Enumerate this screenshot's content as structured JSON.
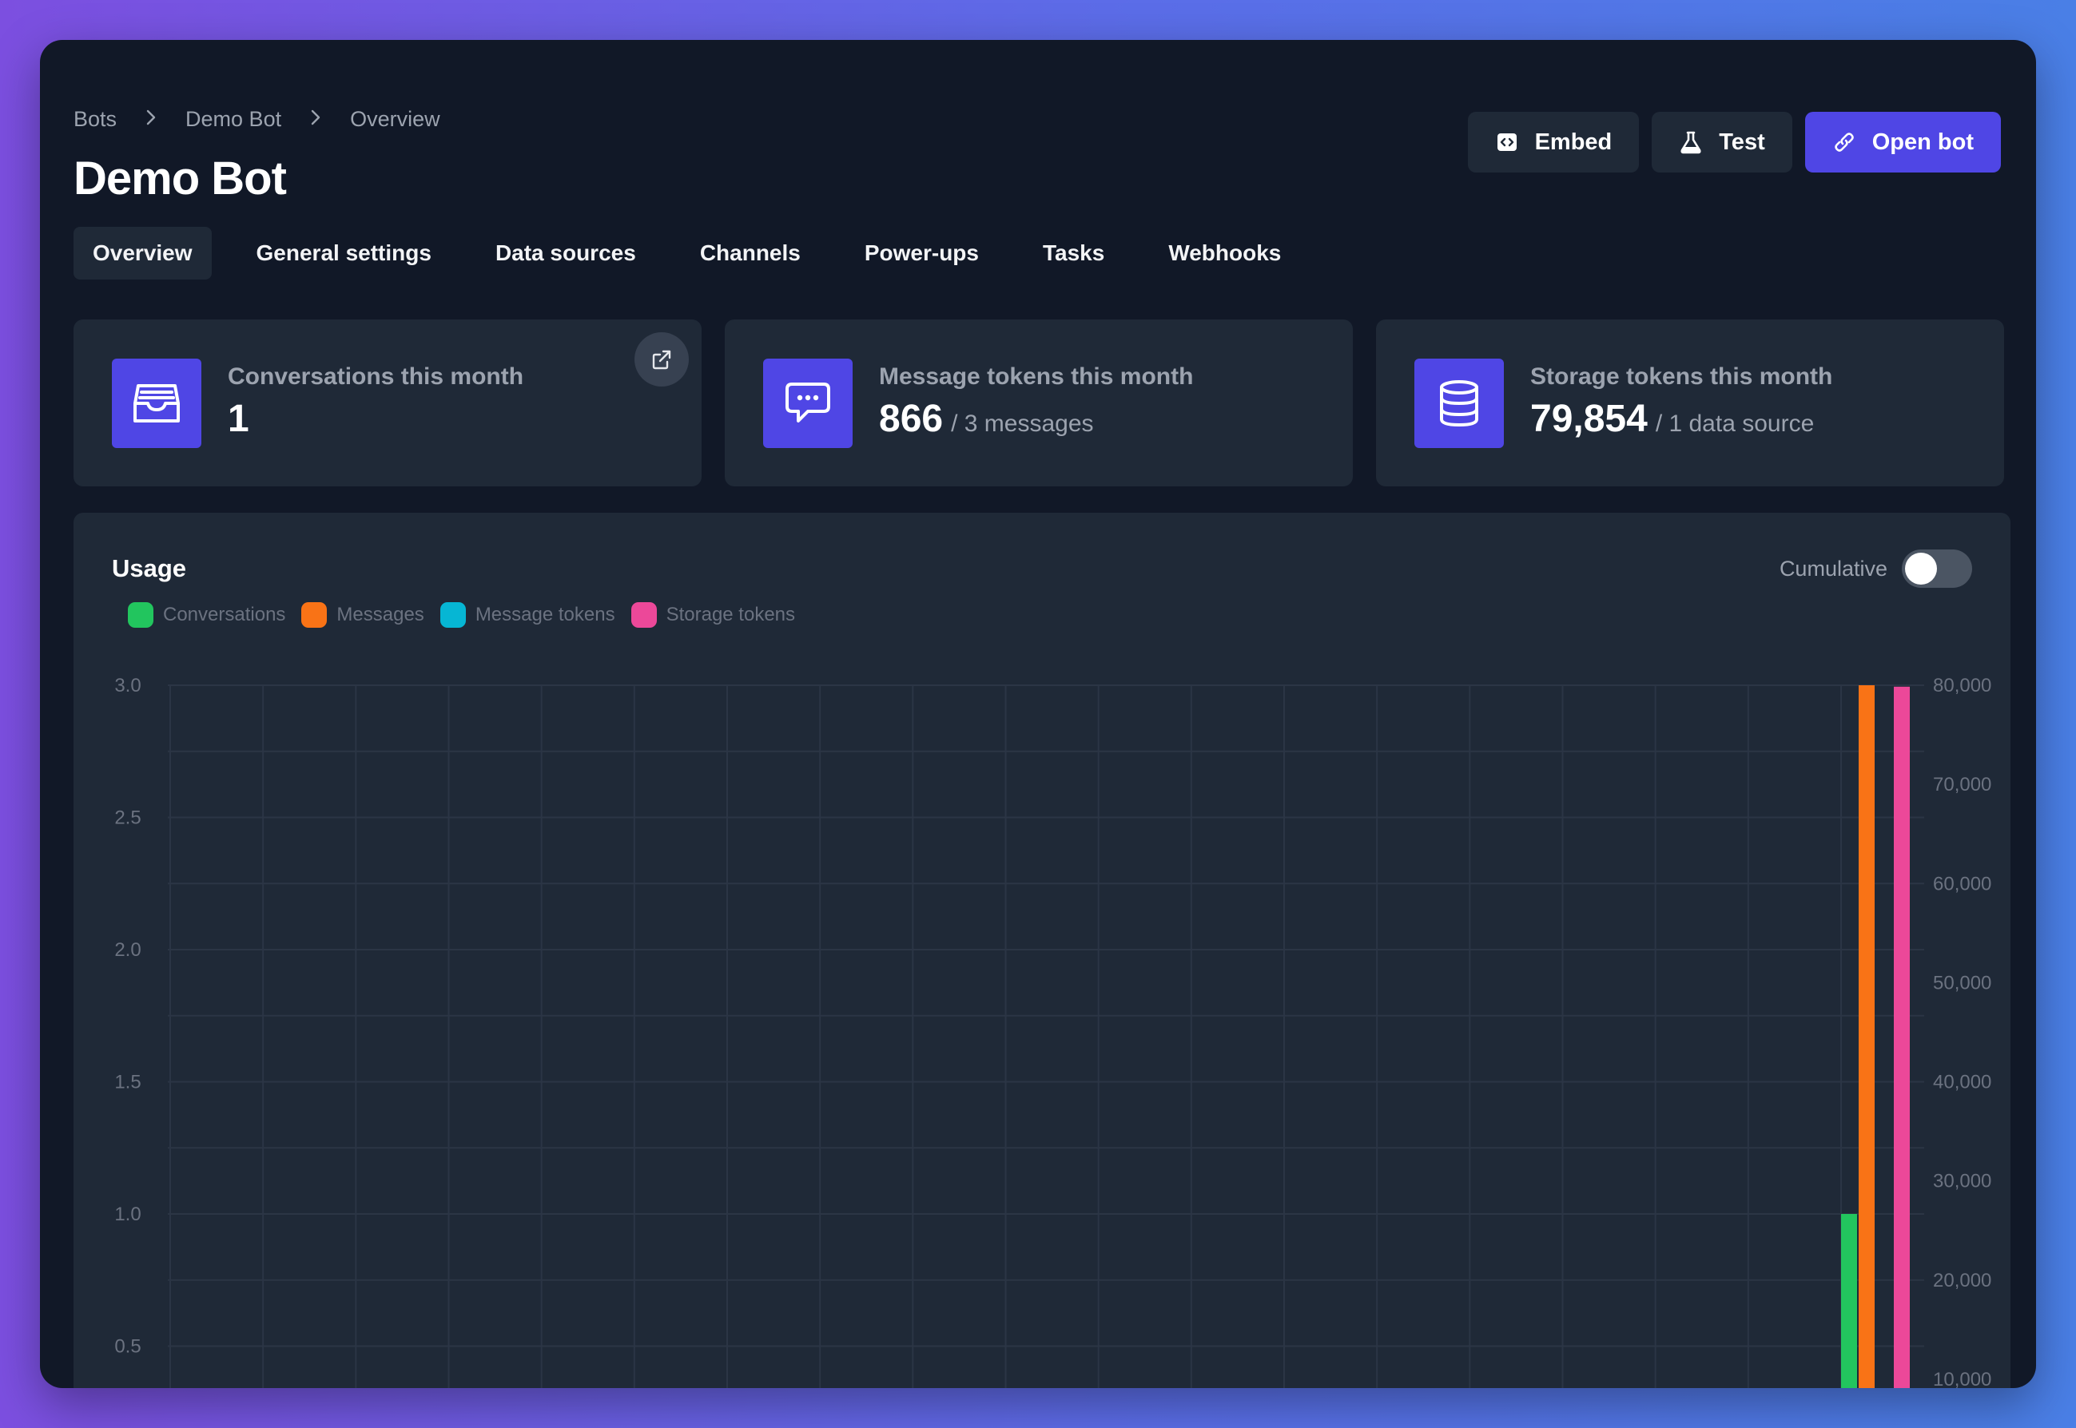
{
  "breadcrumb": [
    "Bots",
    "Demo Bot",
    "Overview"
  ],
  "page_title": "Demo Bot",
  "actions": {
    "embed": "Embed",
    "test": "Test",
    "open_bot": "Open bot"
  },
  "tabs": [
    "Overview",
    "General settings",
    "Data sources",
    "Channels",
    "Power-ups",
    "Tasks",
    "Webhooks"
  ],
  "active_tab": "Overview",
  "stats": [
    {
      "label": "Conversations this month",
      "value": "1",
      "sub": ""
    },
    {
      "label": "Message tokens this month",
      "value": "866",
      "sub": "/ 3 messages"
    },
    {
      "label": "Storage tokens this month",
      "value": "79,854",
      "sub": "/ 1 data source"
    }
  ],
  "usage": {
    "title": "Usage",
    "cumulative_label": "Cumulative",
    "cumulative_on": false
  },
  "colors": {
    "accent": "#4f46e5",
    "conversations": "#22c55e",
    "messages": "#f97316",
    "message_tokens": "#06b6d4",
    "storage_tokens": "#ec4899"
  },
  "chart_data": {
    "type": "bar",
    "legend": [
      "Conversations",
      "Messages",
      "Message tokens",
      "Storage tokens"
    ],
    "legend_position": "top-left",
    "grid": true,
    "y_left": {
      "ticks": [
        "3.0",
        "2.5",
        "2.0",
        "1.5",
        "1.0",
        "0.5"
      ],
      "range": [
        0,
        3
      ]
    },
    "y_right": {
      "ticks": [
        "80,000",
        "70,000",
        "60,000",
        "50,000",
        "40,000",
        "30,000",
        "20,000",
        "10,000"
      ],
      "range": [
        0,
        80000
      ]
    },
    "series": [
      {
        "name": "Conversations",
        "axis": "left",
        "value": 1
      },
      {
        "name": "Messages",
        "axis": "left",
        "value": 3
      },
      {
        "name": "Message tokens",
        "axis": "right",
        "value": 866
      },
      {
        "name": "Storage tokens",
        "axis": "right",
        "value": 79854
      }
    ]
  }
}
